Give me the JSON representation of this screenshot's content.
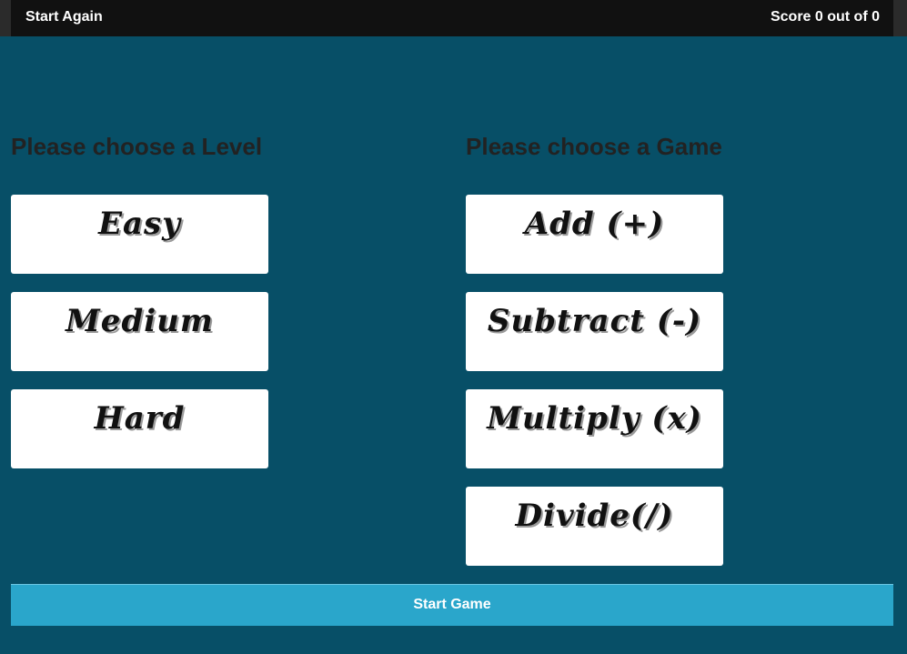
{
  "header": {
    "start_again_label": "Start Again",
    "score_text": "Score 0 out of 0"
  },
  "level_section": {
    "heading": "Please choose a Level",
    "options": [
      "Easy",
      "Medium",
      "Hard"
    ]
  },
  "game_section": {
    "heading": "Please choose a Game",
    "options": [
      "Add (+)",
      "Subtract (-)",
      "Multiply (x)",
      "Divide(/)"
    ]
  },
  "start_game_label": "Start Game",
  "colors": {
    "background": "#074f67",
    "topbar": "#111111",
    "button_accent": "#2aa6cb",
    "card": "#ffffff"
  }
}
